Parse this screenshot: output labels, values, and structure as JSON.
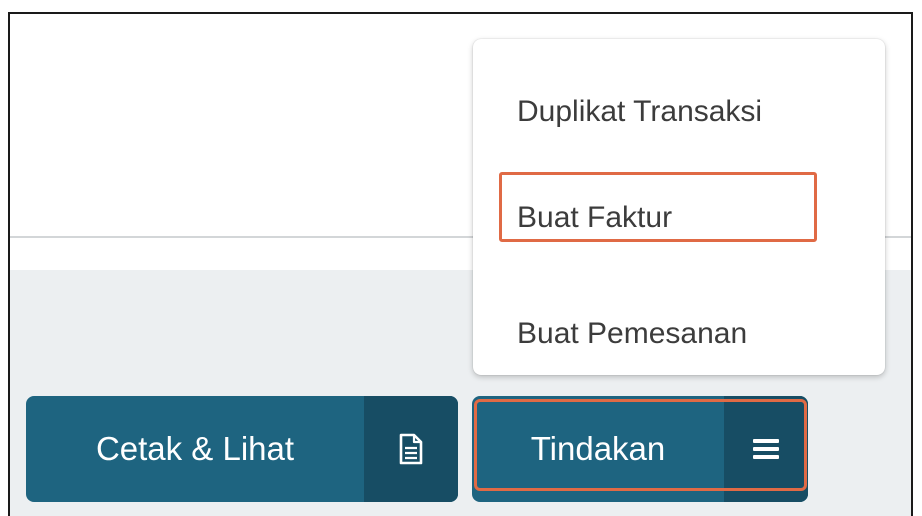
{
  "menu": {
    "items": [
      {
        "label": "Duplikat Transaksi"
      },
      {
        "label": "Buat Faktur"
      },
      {
        "label": "Buat Pemesanan"
      }
    ],
    "highlighted_item": "Buat Faktur"
  },
  "toolbar": {
    "print_label": "Cetak & Lihat",
    "print_icon": "document-icon",
    "action_label": "Tindakan",
    "action_icon": "hamburger-menu-icon"
  },
  "colors": {
    "button_primary": "#1e6480",
    "button_icon_area": "#174d64",
    "highlight_outline": "#e06a45",
    "panel_background": "#eceff1"
  }
}
